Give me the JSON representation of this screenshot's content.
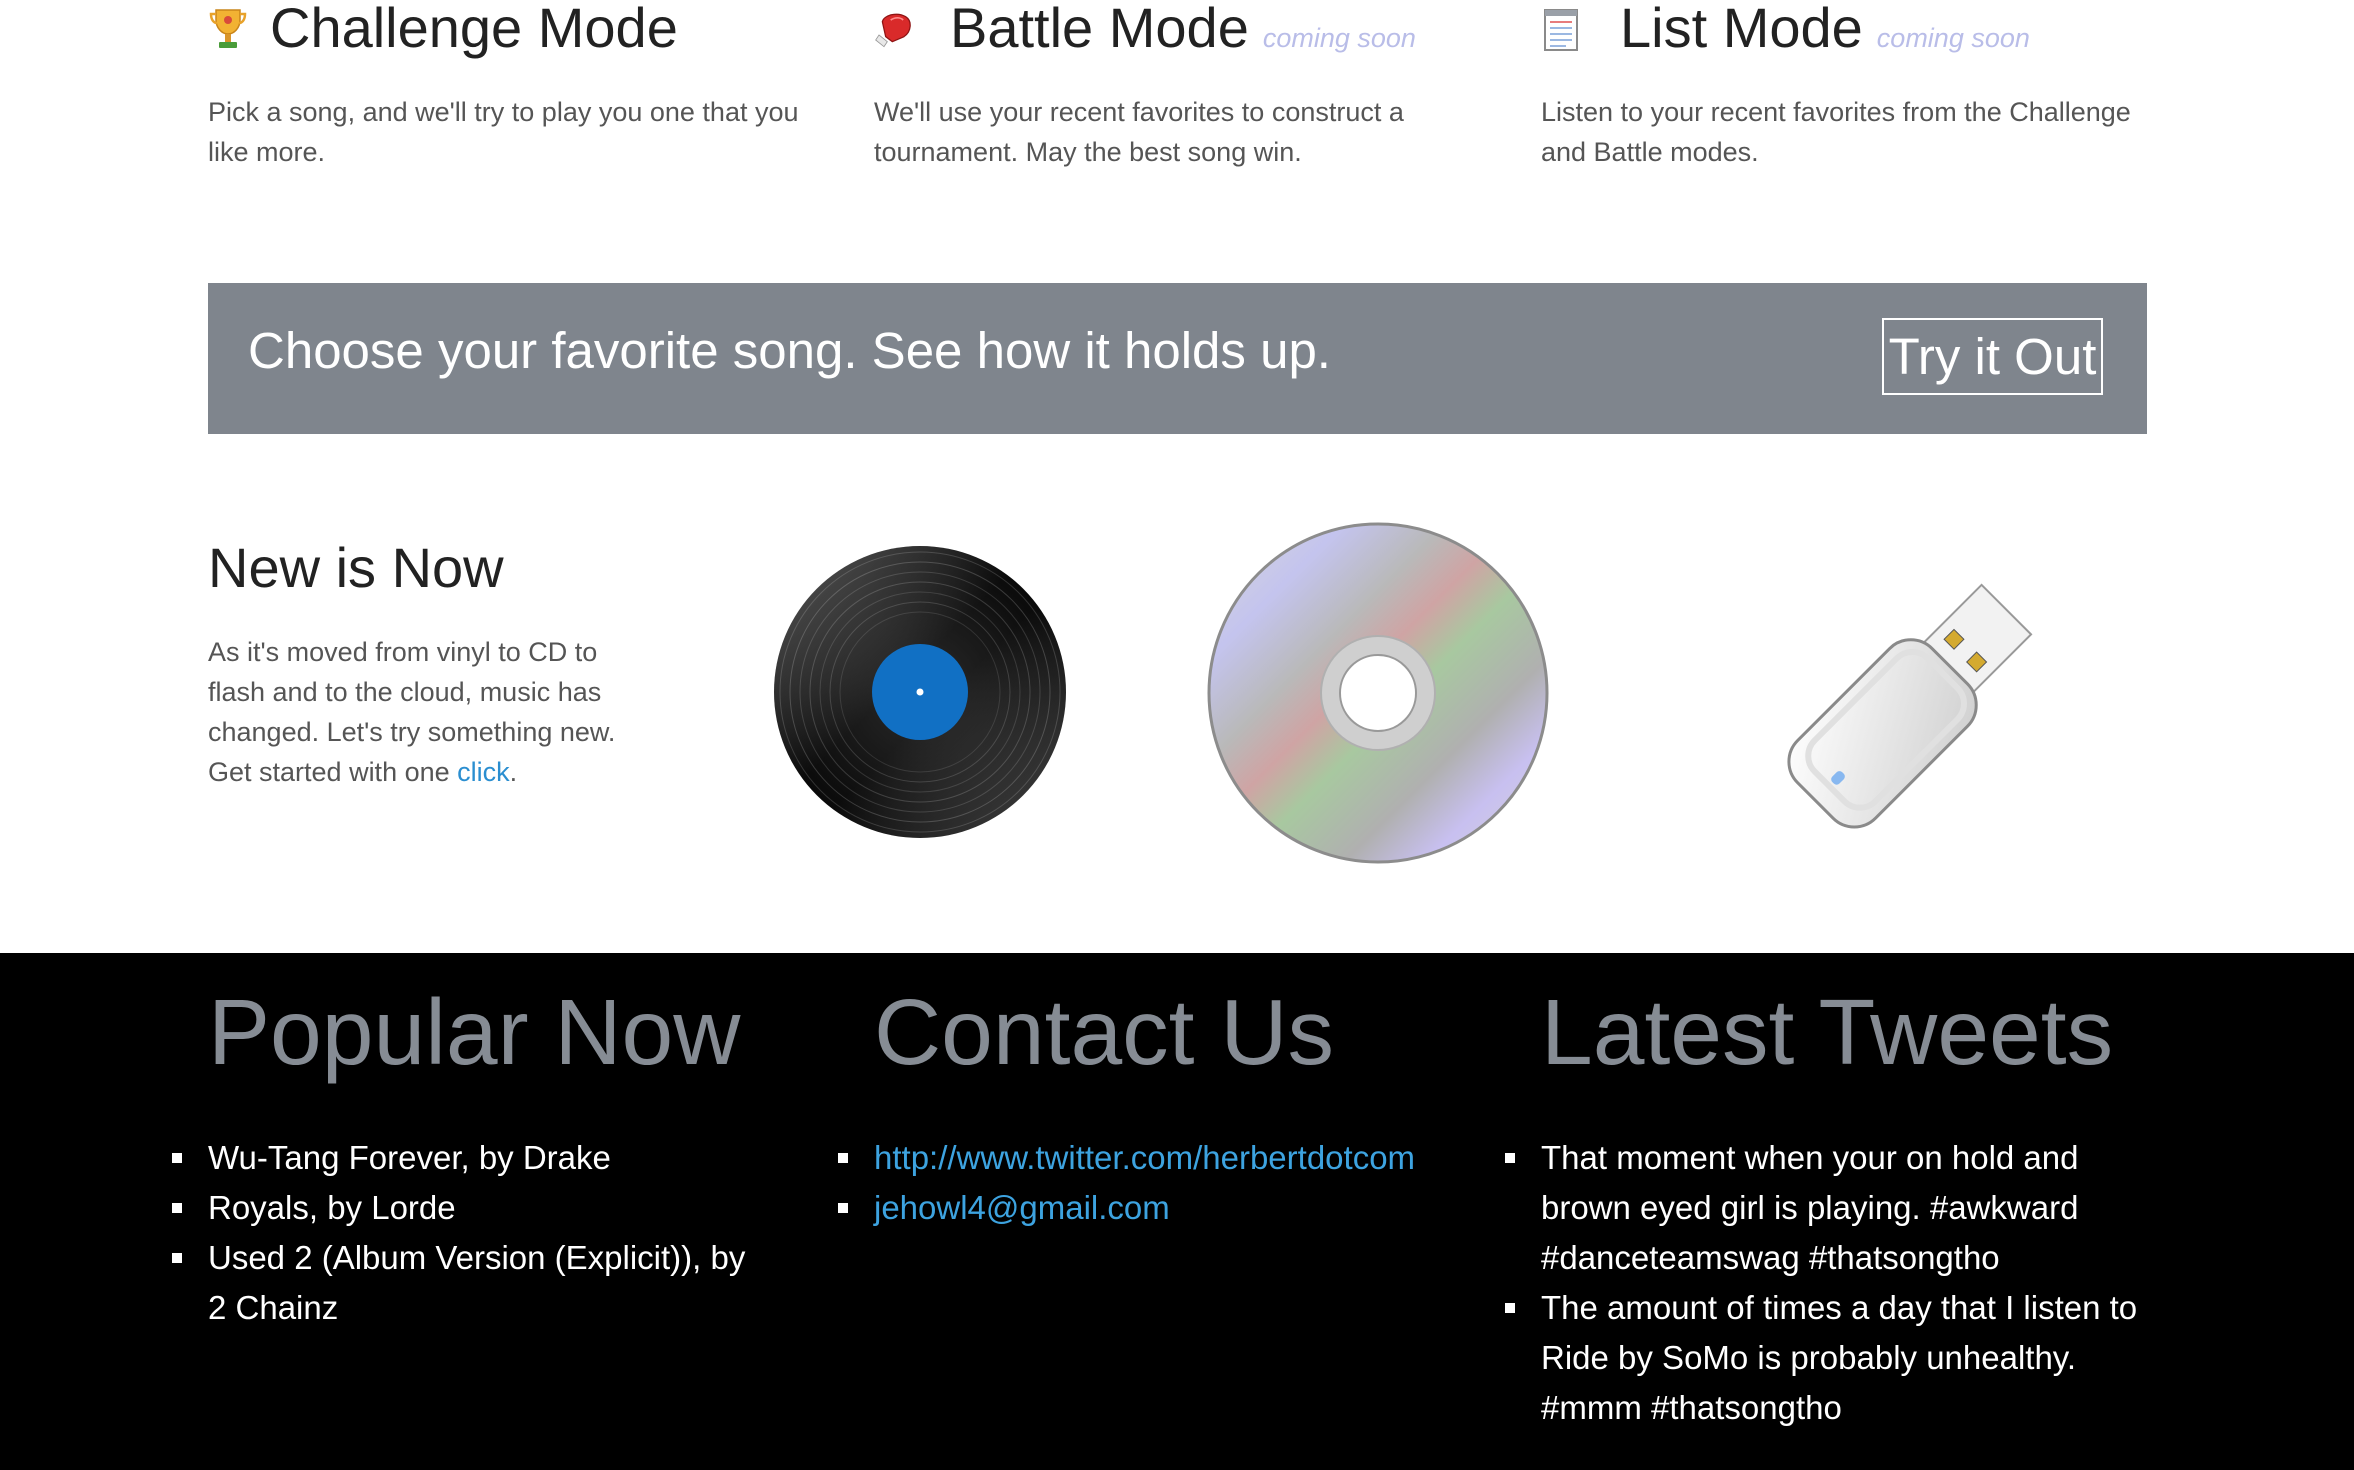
{
  "modes": [
    {
      "icon": "trophy-icon",
      "title": "Challenge Mode",
      "badge": "",
      "description": "Pick a song, and we'll try to play you one that you like more."
    },
    {
      "icon": "boxing-glove-icon",
      "title": "Battle Mode",
      "badge": "coming soon",
      "description": "We'll use your recent favorites to construct a tournament. May the best song win."
    },
    {
      "icon": "notepad-icon",
      "title": "List Mode",
      "badge": "coming soon",
      "description": "Listen to your recent favorites from the Challenge and Battle modes."
    }
  ],
  "banner": {
    "text": "Choose your favorite song. See how it holds up.",
    "button_label": "Try it Out",
    "background": "#7f858d"
  },
  "new_is_now": {
    "title": "New is Now",
    "description": "As it's moved from vinyl to CD to flash and to the cloud, music has changed. Let's try something new. Get started with one ",
    "link_text": "click",
    "trailing": ".",
    "images": [
      "vinyl-record-icon",
      "cd-disc-icon",
      "usb-flash-drive-icon"
    ]
  },
  "footer": {
    "popular": {
      "title": "Popular Now",
      "items": [
        "Wu-Tang Forever, by Drake",
        "Royals, by Lorde",
        "Used 2 (Album Version (Explicit)), by 2 Chainz"
      ]
    },
    "contact": {
      "title": "Contact Us",
      "links": [
        "http://www.twitter.com/herbertdotcom",
        "jehowl4@gmail.com"
      ]
    },
    "tweets": {
      "title": "Latest Tweets",
      "items": [
        "That moment when your on hold and brown eyed girl is playing. #awkward #danceteamswag #thatsongtho",
        "The amount of times a day that I listen to Ride by SoMo is probably unhealthy. #mmm #thatsongtho"
      ]
    }
  },
  "colors": {
    "link": "#2a8ed0",
    "footer_link": "#3da3e0",
    "footer_heading": "#868c94",
    "badge": "#b9bde8"
  }
}
